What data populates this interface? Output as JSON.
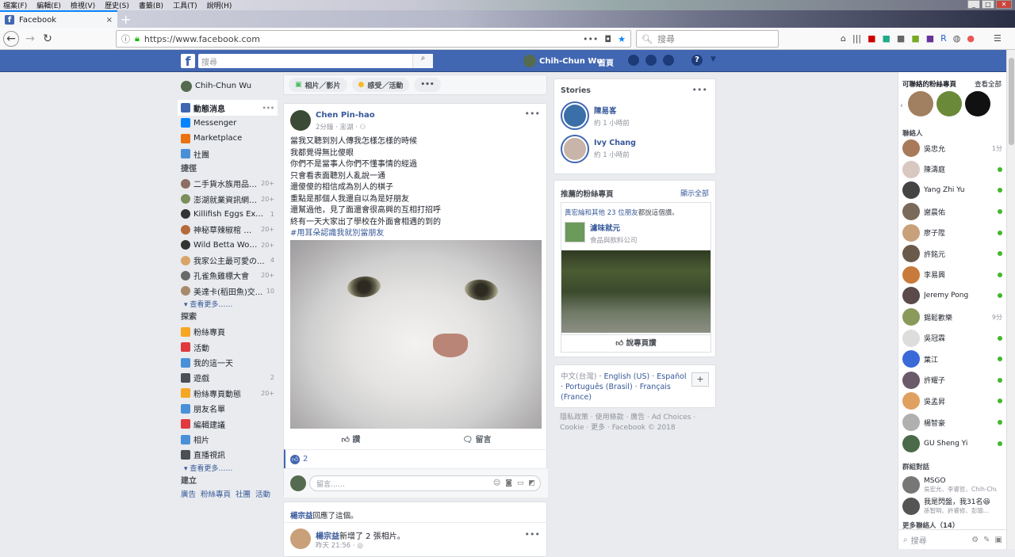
{
  "menu": [
    "檔案(F)",
    "編輯(E)",
    "檢視(V)",
    "歷史(S)",
    "書籤(B)",
    "工具(T)",
    "說明(H)"
  ],
  "tab": {
    "title": "Facebook",
    "close": "×",
    "new": "+"
  },
  "nav": {
    "url": "https://www.facebook.com",
    "url_dots": "•••",
    "search_placeholder": "搜尋"
  },
  "fb": {
    "logo": "f",
    "search_placeholder": "搜尋",
    "user": "Chih-Chun Wu",
    "home": "首頁",
    "help": "?"
  },
  "left": {
    "profile": "Chih-Chun Wu",
    "main": [
      {
        "label": "動態消息",
        "active": true,
        "color": "#4267b2"
      },
      {
        "label": "Messenger",
        "color": "#0084ff"
      },
      {
        "label": "Marketplace",
        "color": "#e9710f"
      },
      {
        "label": "社團",
        "color": "#4a90d9"
      }
    ],
    "shortcuts_title": "捷徑",
    "shortcuts": [
      {
        "label": "二手貨水族用品 ...",
        "count": "20+"
      },
      {
        "label": "澎湖就業資訊網(...",
        "count": "20+"
      },
      {
        "label": "Killifish Eggs Exc...",
        "count": "1"
      },
      {
        "label": "神秘草辣椒棺 水...",
        "count": "20+"
      },
      {
        "label": "Wild Betta World",
        "count": "20+"
      },
      {
        "label": "我家公主最可愛の...",
        "count": "4"
      },
      {
        "label": "孔雀魚雞標大會",
        "count": "20+"
      },
      {
        "label": "美達卡(稻田魚)交...",
        "count": "10"
      }
    ],
    "see_more": "查看更多……",
    "explore_title": "探索",
    "explore": [
      {
        "label": "粉絲專頁",
        "count": "",
        "color": "#f5a623"
      },
      {
        "label": "活動",
        "count": "",
        "color": "#e0393e"
      },
      {
        "label": "我的這一天",
        "count": "",
        "color": "#4a90d9"
      },
      {
        "label": "遊戲",
        "count": "2",
        "color": "#4b4f56"
      },
      {
        "label": "粉絲專頁動態",
        "count": "20+",
        "color": "#f5a623"
      },
      {
        "label": "朋友名單",
        "count": "",
        "color": "#4a90d9"
      },
      {
        "label": "編輯建議",
        "count": "",
        "color": "#e0393e"
      },
      {
        "label": "相片",
        "count": "",
        "color": "#4a90d9"
      },
      {
        "label": "直播視訊",
        "count": "",
        "color": "#4b4f56"
      }
    ],
    "see_more2": "查看更多……",
    "create_title": "建立",
    "create": [
      "廣告",
      "粉絲專頁",
      "社團",
      "活動"
    ]
  },
  "composer": {
    "photo": "相片／影片",
    "feeling": "感受／活動",
    "more": "•••"
  },
  "post": {
    "author": "Chen Pin-hao",
    "time": "2分鐘 · 澎湖 · ",
    "lines": [
      "當我又聽到別人傳我怎樣怎樣的時候",
      "我都覺得無比傻眼",
      "你們不是當事人你們不懂事情的經過",
      "只會看表面聽別人亂說一通",
      "還傻傻的相信成為別人的棋子",
      "重點是那個人我還自以為是好朋友",
      "還幫過他，見了面還會很高興的互相打招呼",
      "終有一天大家出了學校在外面會相遇的到的"
    ],
    "hashtag": "#用耳朵認識我就別當朋友",
    "like": "讚",
    "comment": "留言",
    "likes_count": "2",
    "comment_placeholder": "留言……"
  },
  "post2": {
    "commenter": "楊宗益",
    "action": "回應了這個。",
    "author": "楊宗益",
    "text": "新增了 2 張相片。",
    "time": "昨天 21:56 · "
  },
  "stories": {
    "title": "Stories",
    "items": [
      {
        "name": "陳易峉",
        "time": "約 1 小時前"
      },
      {
        "name": "Ivy Chang",
        "time": "約 1 小時前"
      }
    ]
  },
  "suggest": {
    "title": "推薦的粉絲專頁",
    "see_all": "顯示全部",
    "friends_name": "黃宏綸和其他 23 位朋友",
    "friends_rest": "都說這個讚。",
    "page_name": "濾味就元",
    "page_cat": "食品與飲料公司",
    "like_btn": "說專頁讚"
  },
  "langs": {
    "current": "中文(台灣)",
    "others": [
      "English (US)",
      "Español",
      "Português (Brasil)",
      "Français (France)"
    ],
    "plus": "+"
  },
  "footer": "隱私政策 · 使用條款 · 廣告 · Ad Choices · Cookie · 更多 · Facebook © 2018",
  "chat": {
    "pages_title": "可聯絡的粉絲專頁",
    "see_all": "查看全部",
    "contacts_title": "聯絡人",
    "contacts": [
      {
        "name": "吳忠允",
        "status": "1分"
      },
      {
        "name": "陳濤庭",
        "status": "on"
      },
      {
        "name": "Yang Zhi Yu",
        "status": "on"
      },
      {
        "name": "謝晨佑",
        "status": "on"
      },
      {
        "name": "廖子陞",
        "status": "on"
      },
      {
        "name": "許銘元",
        "status": "on"
      },
      {
        "name": "李易興",
        "status": "on"
      },
      {
        "name": "Jeremy Pong",
        "status": "on"
      },
      {
        "name": "錫鬆歡樂",
        "status": "9分"
      },
      {
        "name": "吳冠霖",
        "status": "on"
      },
      {
        "name": "葉江",
        "status": "on"
      },
      {
        "name": "許耀子",
        "status": "on"
      },
      {
        "name": "吳孟昇",
        "status": "on"
      },
      {
        "name": "楊智豪",
        "status": "on"
      },
      {
        "name": "GU Sheng Yi",
        "status": "on"
      }
    ],
    "groups_title": "群組對話",
    "groups": [
      {
        "name": "MSGO",
        "members": "吳宏允、李睿哲、Chih-Chun ..."
      },
      {
        "name": "我是閃盤，我31名😆",
        "members": "孫智明、許睿修、彭瑜..."
      }
    ],
    "more_contacts": "更多聯絡人（14）",
    "search_placeholder": "搜尋"
  }
}
